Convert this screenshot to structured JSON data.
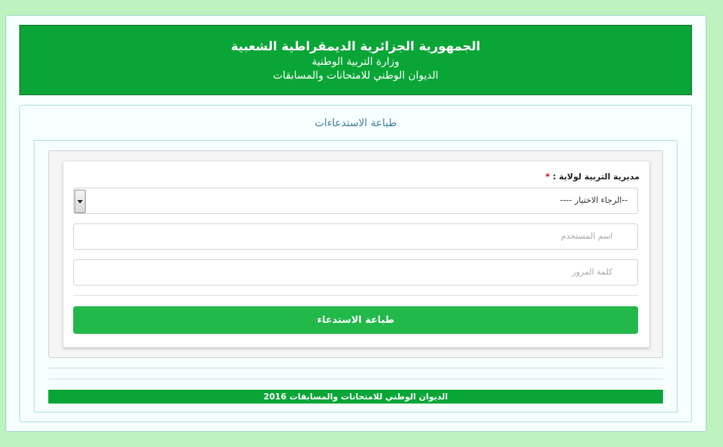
{
  "header": {
    "line1": "الجمهورية الجزائرية الديمقراطية الشعبية",
    "line2": "وزارة التربية الوطنية",
    "line3": "الديوان الوطني للامتحانات والمسابقات"
  },
  "panel": {
    "title": "طباعة الاستدعاءات"
  },
  "form": {
    "directorate_label": "مديرية التربية لولاية :",
    "required_mark": "*",
    "directorate_select_value": "--الرجاء الاختيار ----",
    "username_placeholder": "اسم المستخدم",
    "password_placeholder": "كلمة المرور",
    "submit_label": "طباعة الاستدعاء"
  },
  "footer": {
    "text": "الديوان الوطني للامتحانات والمسابقات 2016"
  },
  "colors": {
    "background": "#bef2bf",
    "banner_green": "#0aa537",
    "button_green": "#22b84a",
    "title_blue": "#3f7f9a",
    "required_red": "#d0021b"
  },
  "icons": {
    "select_arrow": "chevron-down-icon"
  }
}
